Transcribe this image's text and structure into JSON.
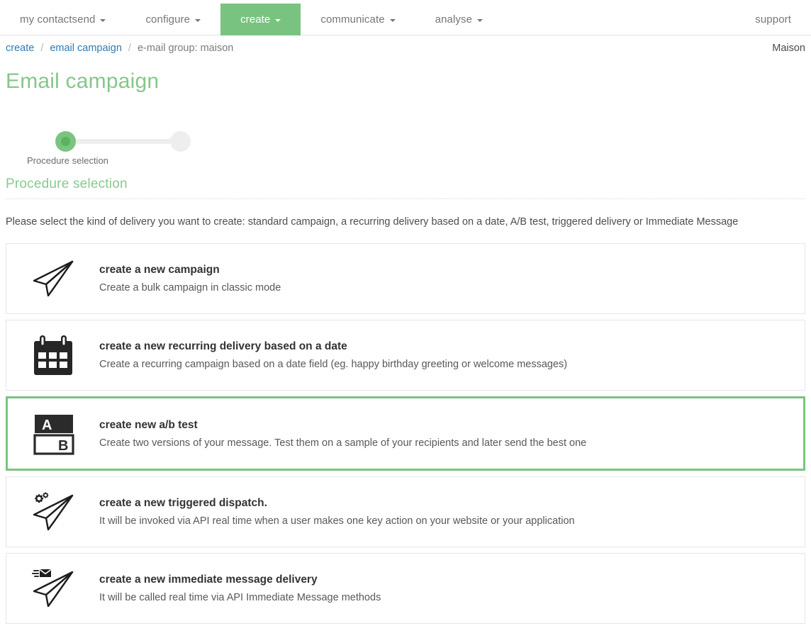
{
  "topbar_colors": [
    "#1273b8",
    "#6ec6d0",
    "#79c381",
    "#f6ab2f",
    "#e8493f",
    "#ffffff",
    "#7b54b8"
  ],
  "nav": {
    "items": [
      {
        "label": "my contactsend",
        "has_caret": true,
        "active": false
      },
      {
        "label": "configure",
        "has_caret": true,
        "active": false
      },
      {
        "label": "create",
        "has_caret": true,
        "active": true
      },
      {
        "label": "communicate",
        "has_caret": true,
        "active": false
      },
      {
        "label": "analyse",
        "has_caret": true,
        "active": false
      }
    ],
    "support": {
      "label": "support",
      "has_caret": false
    }
  },
  "breadcrumb": {
    "items": [
      {
        "label": "create",
        "link": true
      },
      {
        "label": "email campaign",
        "link": true
      },
      {
        "label": "e-mail group: maison",
        "link": false
      }
    ],
    "separator": "/",
    "account": "Maison"
  },
  "page": {
    "title": "Email campaign",
    "section_heading": "Procedure selection",
    "section_description": "Please select the kind of delivery you want to create: standard campaign, a recurring delivery based on a date, A/B test, triggered delivery or Immediate Message"
  },
  "stepper": {
    "steps": [
      {
        "label": "Procedure selection",
        "state": "current"
      },
      {
        "label": "",
        "state": "pending"
      }
    ],
    "active_color": "#7ac47f",
    "inactive_color": "#eeeeee"
  },
  "options": [
    {
      "icon": "paper-plane-icon",
      "title": "create a new campaign",
      "description": "Create a bulk campaign in classic mode",
      "selected": false
    },
    {
      "icon": "calendar-icon",
      "title": "create a new recurring delivery based on a date",
      "description": "Create a recurring campaign based on a date field (eg. happy birthday greeting or welcome messages)",
      "selected": false
    },
    {
      "icon": "ab-test-icon",
      "title": "create new a/b test",
      "description": "Create two versions of your message. Test them on a sample of your recipients and later send the best one",
      "selected": true,
      "icon_labels": {
        "a": "A",
        "b": "B"
      }
    },
    {
      "icon": "paper-plane-gear-icon",
      "title": "create a new triggered dispatch.",
      "description": "It will be invoked via API real time when a user makes one key action on your website or your application",
      "selected": false
    },
    {
      "icon": "paper-plane-envelope-icon",
      "title": "create a new immediate message delivery",
      "description": "It will be called real time via API Immediate Message methods",
      "selected": false
    }
  ],
  "colors": {
    "accent_green": "#7ac47f",
    "title_green": "#86c68b",
    "link_blue": "#2e7bb5"
  }
}
